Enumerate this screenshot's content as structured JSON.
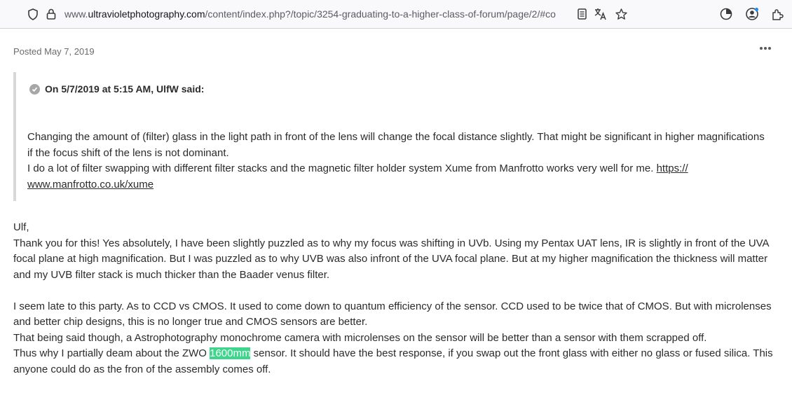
{
  "browser": {
    "url_prefix": "www.",
    "url_host": "ultravioletphotography.com",
    "url_path": "/content/index.php?/topic/3254-graduating-to-a-higher-class-of-forum/page/2/#co"
  },
  "post": {
    "posted_label": "Posted",
    "posted_date": "May 7, 2019",
    "quote": {
      "header": "On 5/7/2019 at 5:15 AM, UlfW said:",
      "line1": "Changing the amount of (filter) glass in the light path in front of the lens will change the focal distance slightly. That might be significant in higher magnifications",
      "line2": "if the focus shift of the lens is not dominant.",
      "line3": "I do a lot of filter swapping with different filter stacks and the magnetic filter holder system Xume from Manfrotto works very well for me. ",
      "link_part1": "https://",
      "link_part2": "www.manfrotto.co.uk/xume"
    },
    "body": {
      "greeting": "Ulf,",
      "p1_l1": "Thank you for this! Yes absolutely, I have been slightly puzzled as to why my focus was shifting in UVb. Using my Pentax UAT lens, IR is slightly in front of the UVA",
      "p1_l2": "focal plane at high magnification. But I was puzzled as to why UVB was also infront of the UVA focal plane. But at my higher magnification the thickness will matter",
      "p1_l3": "and my UVB filter stack is much thicker than the Baader venus filter.",
      "p2_l1": "I seem late to this party. As to CCD vs CMOS. It used to come down to quantum efficiency of the sensor. CCD used to be twice that of CMOS. But with microlenses",
      "p2_l2": "and better chip designs, this is no longer true and CMOS sensors are better.",
      "p2_l3": "That being said though, a Astrophotography monochrome camera with microlenses on the sensor will be better than a sensor with them scrapped off.",
      "p2_l4_a": "Thus why I partially deam about the ZWO ",
      "p2_l4_hl": "1600mm",
      "p2_l4_b": " sensor. It should have the best response, if you swap out the front glass with either no glass or fused silica. This",
      "p2_l5": "anyone could do as the fron of the assembly comes off."
    }
  },
  "colors": {
    "highlight": "#3dd68c",
    "quote_border": "#d8d8d8"
  },
  "icons": [
    "shield-icon",
    "lock-icon",
    "reader-view-icon",
    "translate-icon",
    "star-icon",
    "pie-chart-icon",
    "account-icon",
    "extensions-icon",
    "more-options-icon",
    "check-icon"
  ]
}
